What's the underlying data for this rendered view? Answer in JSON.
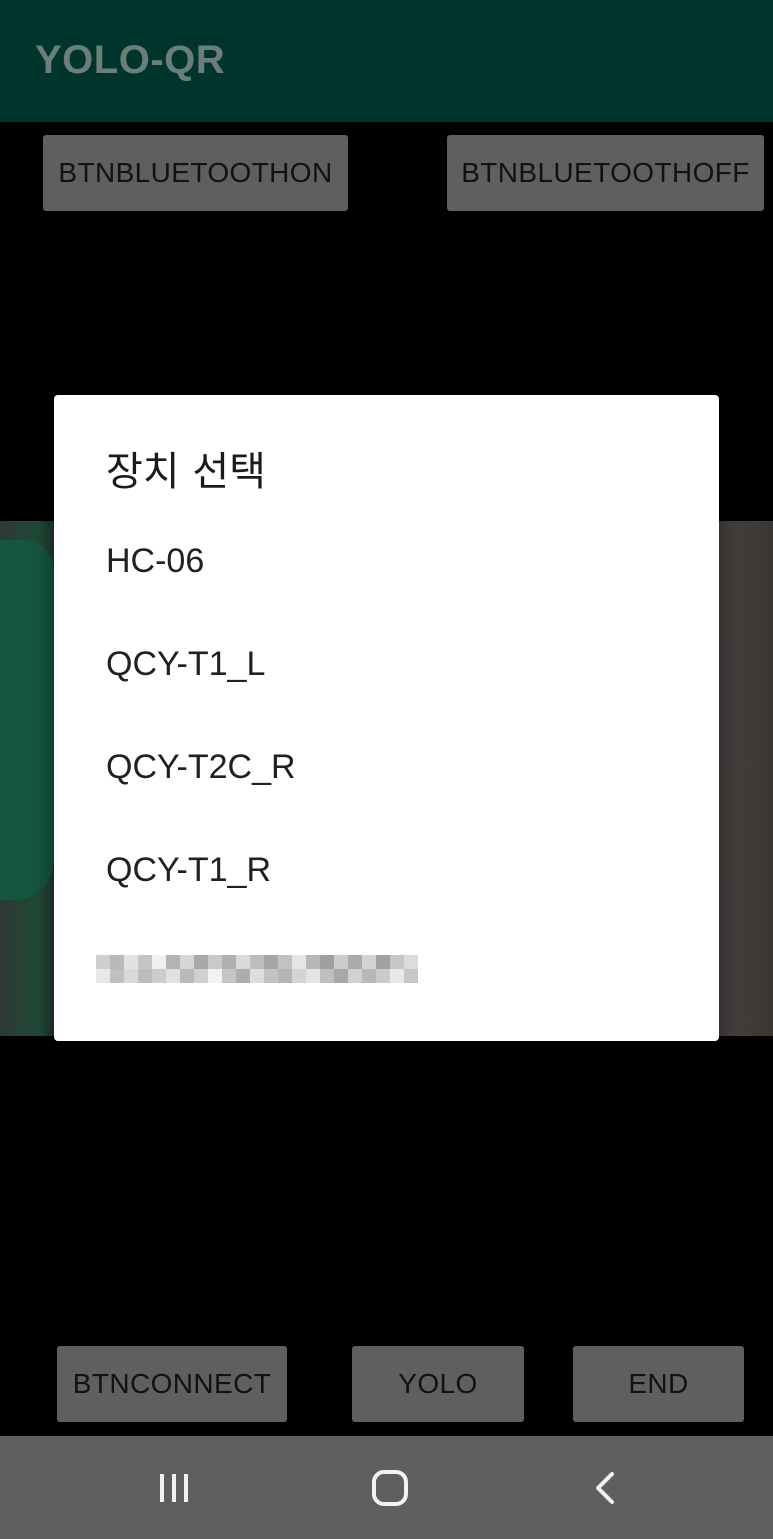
{
  "app": {
    "title": "YOLO-QR"
  },
  "top_buttons": {
    "bluetooth_on_label": "BTNBLUETOOTHON",
    "bluetooth_off_label": "BTNBLUETOOTHOFF"
  },
  "bottom_buttons": {
    "connect_label": "BTNCONNECT",
    "yolo_label": "YOLO",
    "end_label": "END"
  },
  "dialog": {
    "title": "장치 선택",
    "devices": [
      {
        "label": "HC-06"
      },
      {
        "label": "QCY-T1_L"
      },
      {
        "label": "QCY-T2C_R"
      },
      {
        "label": "QCY-T1_R"
      }
    ],
    "redacted_item_icon": "pixelated-redaction"
  },
  "navbar": {
    "recent_icon": "recent-apps-icon",
    "home_icon": "home-icon",
    "back_icon": "back-icon"
  },
  "colors": {
    "appbar": "#00352d",
    "scrim_button": "#5f5f5f",
    "dialog_bg": "#ffffff",
    "navbar": "#5f5f5f"
  }
}
